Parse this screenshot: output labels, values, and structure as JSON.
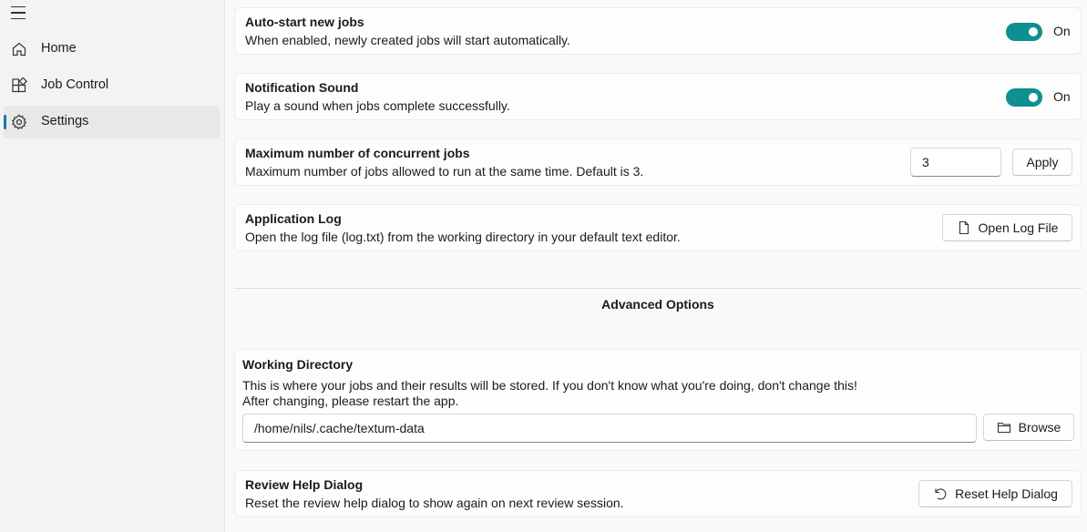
{
  "sidebar": {
    "items": [
      {
        "label": "Home",
        "icon": "home-icon"
      },
      {
        "label": "Job Control",
        "icon": "apps-icon"
      },
      {
        "label": "Settings",
        "icon": "gear-icon",
        "active": true
      }
    ],
    "accent_color": "#0d7fa6"
  },
  "settings": {
    "auto_start": {
      "title": "Auto-start new jobs",
      "description": "When enabled, newly created jobs will start automatically.",
      "state_label": "On"
    },
    "notification_sound": {
      "title": "Notification Sound",
      "description": "Play a sound when jobs complete successfully.",
      "state_label": "On"
    },
    "max_jobs": {
      "title": "Maximum number of concurrent jobs",
      "description": "Maximum number of jobs allowed to run at the same time. Default is 3.",
      "value": "3",
      "apply_label": "Apply"
    },
    "app_log": {
      "title": "Application Log",
      "description": "Open the log file (log.txt) from the working directory in your default text editor.",
      "button_label": "Open Log File"
    },
    "advanced_title": "Advanced Options",
    "working_dir": {
      "title": "Working Directory",
      "description_line1": "This is where your jobs and their results will be stored. If you don't know what you're doing, don't change this!",
      "description_line2": "After changing, please restart the app.",
      "path": "/home/nils/.cache/textum-data",
      "browse_label": "Browse"
    },
    "review_help": {
      "title": "Review Help Dialog",
      "description": "Reset the review help dialog to show again on next review session.",
      "button_label": "Reset Help Dialog"
    }
  },
  "colors": {
    "toggle_on": "#0f8f8f"
  }
}
